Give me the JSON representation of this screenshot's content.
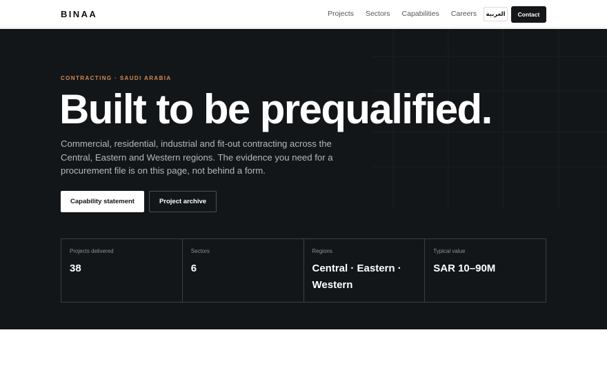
{
  "header": {
    "logo": "BINAA",
    "nav": [
      "Projects",
      "Sectors",
      "Capabilities",
      "Careers"
    ],
    "language_toggle": "العربية",
    "contact_label": "Contact"
  },
  "hero": {
    "eyebrow": "CONTRACTING · SAUDI ARABIA",
    "headline": "Built to be prequalified.",
    "lede": "Commercial, residential, industrial and fit-out contracting across the Central, Eastern and Western regions. The evidence you need for a procurement file is on this page, not behind a form.",
    "primary_cta": "Capability statement",
    "secondary_cta": "Project archive"
  },
  "stats": [
    {
      "label": "Projects delivered",
      "value": "38"
    },
    {
      "label": "Sectors",
      "value": "6"
    },
    {
      "label": "Regions",
      "value": "Central · Eastern · Western"
    },
    {
      "label": "Typical value",
      "value": "SAR 10–90M"
    }
  ]
}
